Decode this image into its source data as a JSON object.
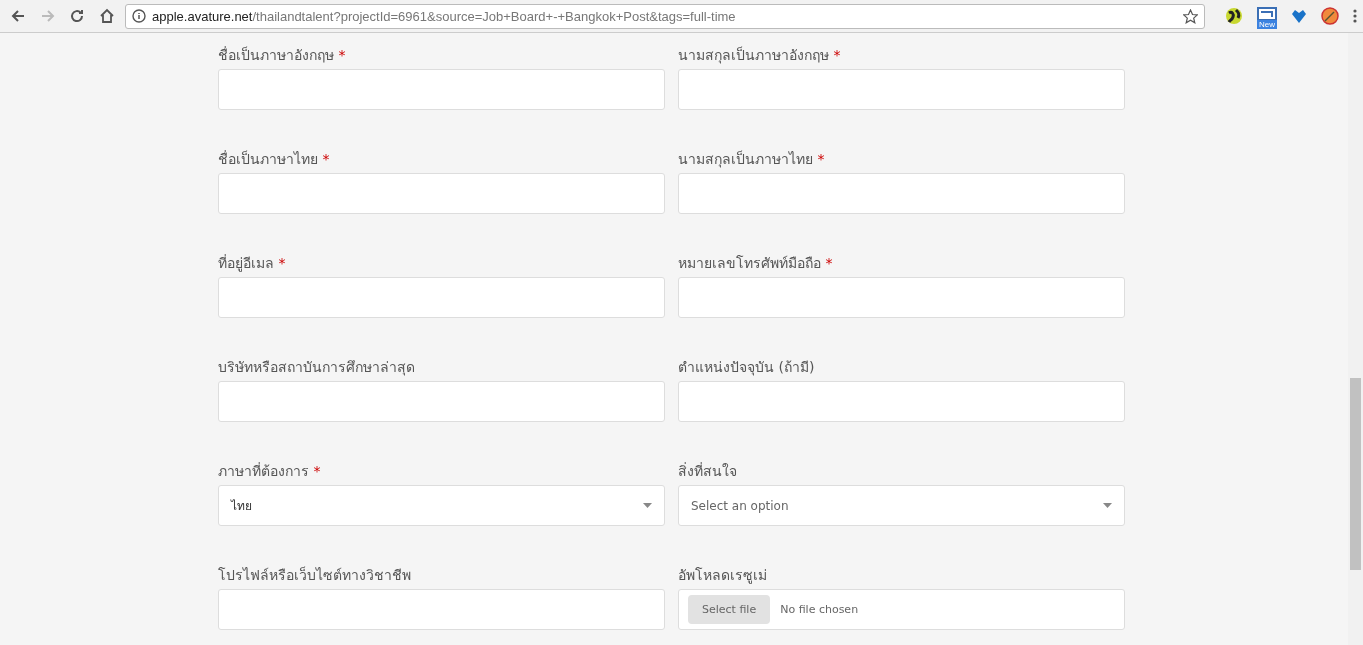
{
  "browser": {
    "address": {
      "domain": "apple.avature.net",
      "path": "/thailandtalent?projectId=6961&source=Job+Board+-+Bangkok+Post&tags=full-time"
    },
    "extension_badge": "New"
  },
  "form": {
    "fields": [
      {
        "kind": "text",
        "label": "ชื่อเป็นภาษาอังกฤษ",
        "required_mark": "*"
      },
      {
        "kind": "text",
        "label": "นามสกุลเป็นภาษาอังกฤษ",
        "required_mark": "*"
      },
      {
        "kind": "text",
        "label": "ชื่อเป็นภาษาไทย",
        "required_mark": "*"
      },
      {
        "kind": "text",
        "label": "นามสกุลเป็นภาษาไทย",
        "required_mark": "*"
      },
      {
        "kind": "text",
        "label": "ที่อยู่อีเมล",
        "required_mark": "*"
      },
      {
        "kind": "text",
        "label": "หมายเลขโทรศัพท์มือถือ",
        "required_mark": "*"
      },
      {
        "kind": "text",
        "label": "บริษัทหรือสถาบันการศึกษาล่าสุด"
      },
      {
        "kind": "text",
        "label": "ตำแหน่งปัจจุบัน (ถ้ามี)"
      },
      {
        "kind": "select",
        "label": "ภาษาที่ต้องการ",
        "required_mark": "*",
        "value": "ไทย"
      },
      {
        "kind": "select",
        "label": "สิ่งที่สนใจ",
        "placeholder": "Select an option"
      },
      {
        "kind": "text",
        "label": "โปรไฟล์หรือเว็บไซต์ทางวิชาชีพ"
      },
      {
        "kind": "file",
        "label": "อัพโหลดเรซูเม่",
        "button": "Select file",
        "status": "No file chosen"
      }
    ]
  }
}
